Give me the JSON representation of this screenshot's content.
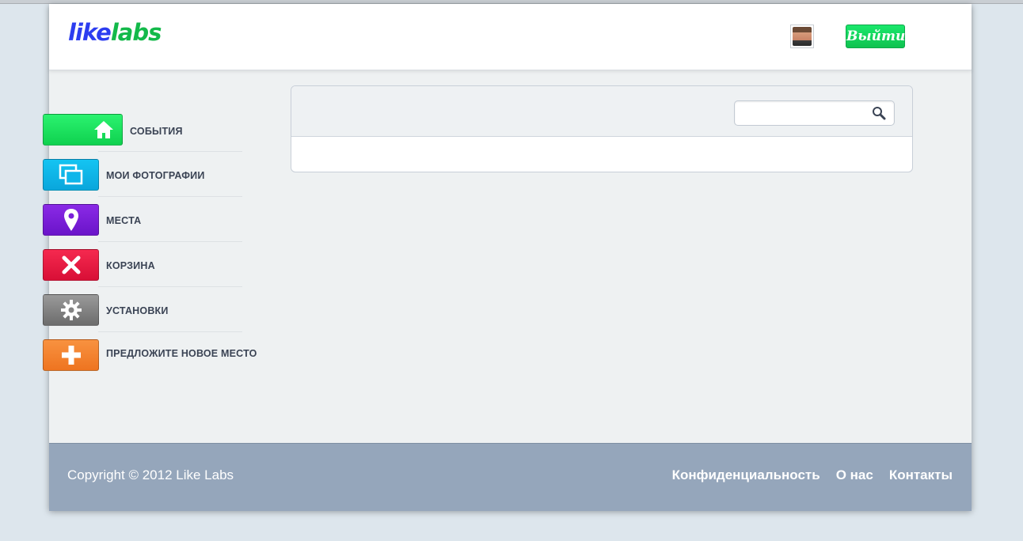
{
  "header": {
    "logo_part1": "like",
    "logo_part2": "labs",
    "logout_label": "Выйти"
  },
  "sidebar": {
    "items": [
      {
        "label": "СОБЫТИЯ",
        "icon": "home-icon",
        "color": "#1ee35f"
      },
      {
        "label": "МОИ ФОТОГРАФИИ",
        "icon": "photos-icon",
        "color": "#0fb6ea"
      },
      {
        "label": "МЕСТА",
        "icon": "map-pin-icon",
        "color": "#7a1fd9"
      },
      {
        "label": "КОРЗИНА",
        "icon": "close-icon",
        "color": "#e81c42"
      },
      {
        "label": "УСТАНОВКИ",
        "icon": "gear-icon",
        "color": "#838383"
      },
      {
        "label": "ПРЕДЛОЖИТЕ НОВОЕ МЕСТО",
        "icon": "plus-icon",
        "color": "#f28430"
      }
    ]
  },
  "search": {
    "value": "",
    "placeholder": "",
    "icon": "search-icon"
  },
  "footer": {
    "copyright": "Copyright © 2012 Like Labs",
    "links": [
      "Конфиденциальность",
      "О нас",
      "Контакты"
    ]
  }
}
